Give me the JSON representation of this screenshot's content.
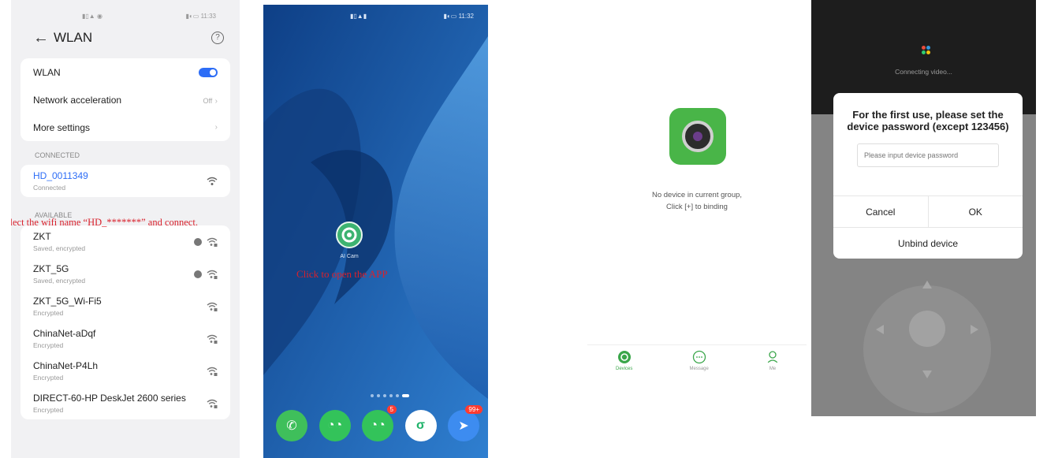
{
  "wlan": {
    "status_left": "▮▯▲ ◉",
    "status_right": "▮◐▭ 11:33",
    "title": "WLAN",
    "wlan_label": "WLAN",
    "accel_label": "Network acceleration",
    "accel_value": "Off",
    "more_label": "More settings",
    "connected_header": "CONNECTED",
    "connected": {
      "name": "HD_0011349",
      "sub": "Connected"
    },
    "available_header": "AVAILABLE",
    "networks": [
      {
        "name": "ZKT",
        "sub": "Saved, encrypted",
        "saved": true
      },
      {
        "name": "ZKT_5G",
        "sub": "Saved, encrypted",
        "saved": true
      },
      {
        "name": "ZKT_5G_Wi-Fi5",
        "sub": "Encrypted",
        "saved": false
      },
      {
        "name": "ChinaNet-aDqf",
        "sub": "Encrypted",
        "saved": false
      },
      {
        "name": "ChinaNet-P4Lh",
        "sub": "Encrypted",
        "saved": false
      },
      {
        "name": "DIRECT-60-HP DeskJet 2600 series",
        "sub": "Encrypted",
        "saved": false
      }
    ],
    "hint": "Select the wifi name “HD_*******” and connect."
  },
  "home": {
    "status_left": "▮▯▲▮",
    "status_right": "▮◐▭ 11:32",
    "app_label": "AI Cam",
    "hint": "Click to open the APP",
    "dock_badges": [
      "5",
      "99+"
    ]
  },
  "app": {
    "empty_line1": "No device in current group,",
    "empty_line2": "Click [+] to binding",
    "tabs": [
      "Devices",
      "Message",
      "Me"
    ]
  },
  "dialog": {
    "connecting": "Connecting video...",
    "title": "For the first use, please set the device password (except 123456)",
    "placeholder": "Please input device password",
    "cancel": "Cancel",
    "ok": "OK",
    "unbind": "Unbind device"
  },
  "colors": {
    "accent": "#2d6df6",
    "hint_red": "#d9212c",
    "app_green": "#49b548"
  }
}
